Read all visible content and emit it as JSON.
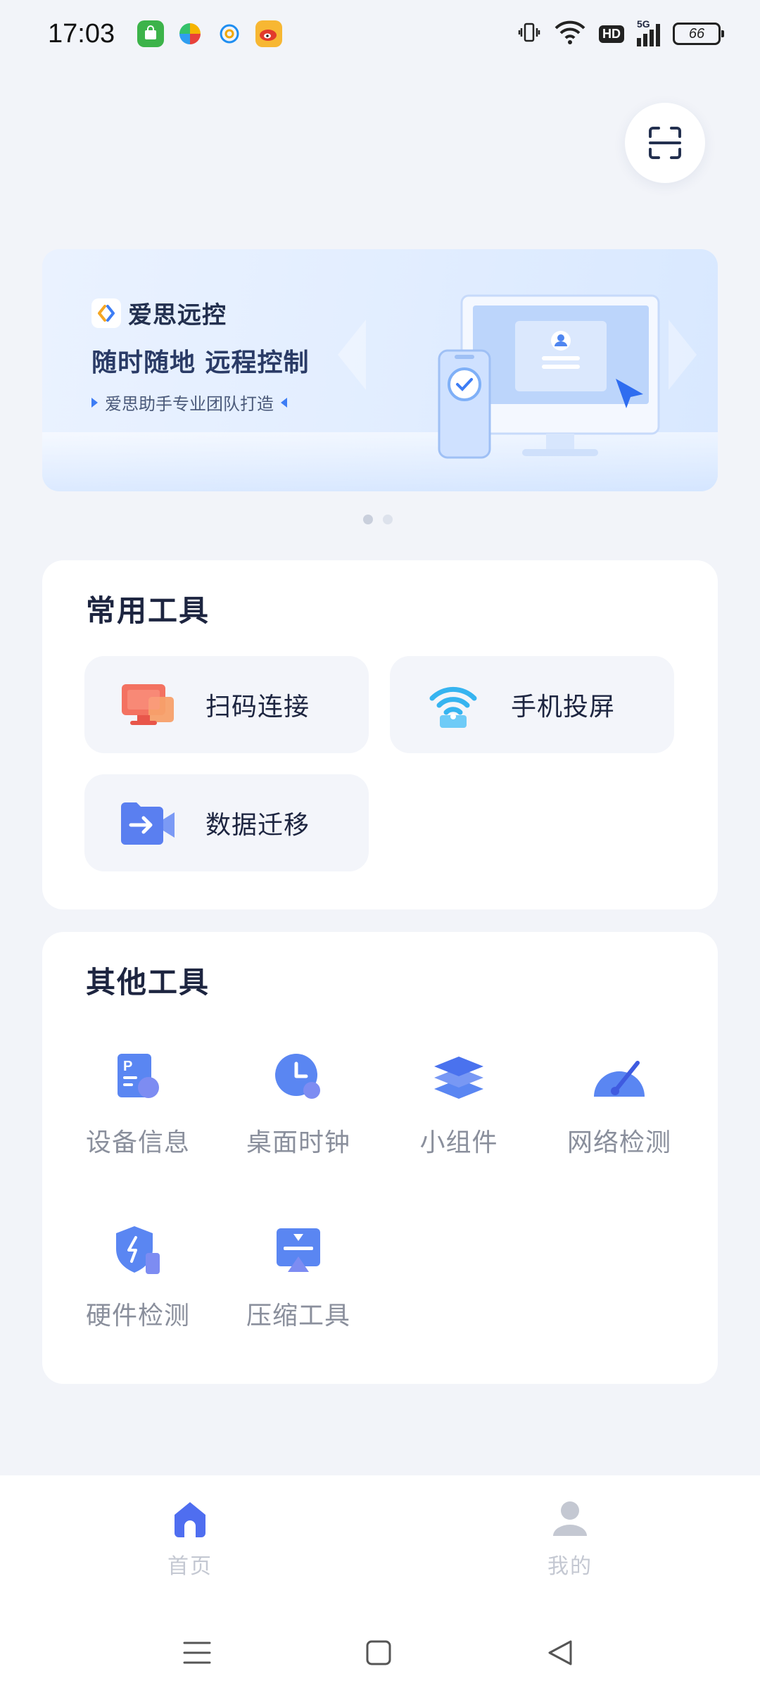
{
  "status_bar": {
    "time": "17:03",
    "battery": "66",
    "network": "5G",
    "hd": "HD"
  },
  "scan_button": {
    "icon": "scan-frame-icon"
  },
  "banner": {
    "brand": "爱思远控",
    "headline": "随时随地 远程控制",
    "subline": "爱思助手专业团队打造"
  },
  "carousel": {
    "current": 1,
    "total": 2
  },
  "common_tools": {
    "title": "常用工具",
    "items": [
      {
        "label": "扫码连接",
        "icon": "monitor-icon"
      },
      {
        "label": "手机投屏",
        "icon": "wifi-cast-icon"
      },
      {
        "label": "数据迁移",
        "icon": "folder-transfer-icon"
      }
    ]
  },
  "other_tools": {
    "title": "其他工具",
    "items": [
      {
        "label": "设备信息",
        "icon": "device-info-icon"
      },
      {
        "label": "桌面时钟",
        "icon": "clock-icon"
      },
      {
        "label": "小组件",
        "icon": "widget-layers-icon"
      },
      {
        "label": "网络检测",
        "icon": "speed-gauge-icon"
      },
      {
        "label": "硬件检测",
        "icon": "shield-bolt-icon"
      },
      {
        "label": "压缩工具",
        "icon": "compress-icon"
      }
    ]
  },
  "bottom_nav": {
    "home": "首页",
    "mine": "我的"
  },
  "colors": {
    "accent": "#4f6ef0",
    "background": "#f2f4f9",
    "card": "#ffffff"
  }
}
